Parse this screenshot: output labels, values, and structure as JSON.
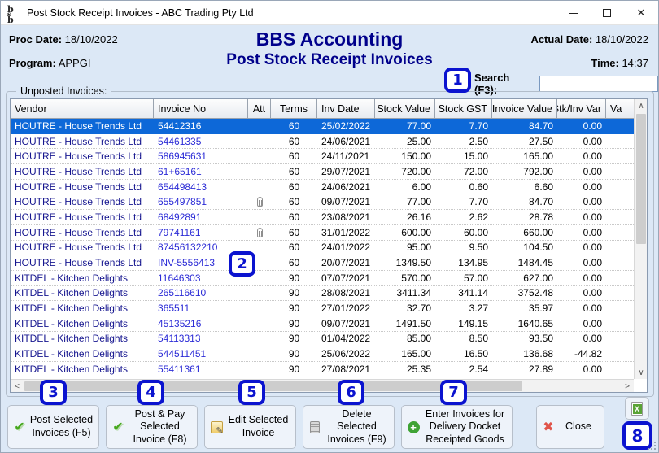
{
  "window": {
    "title": "Post Stock Receipt Invoices - ABC Trading Pty Ltd",
    "app_icon": "bbs-logo"
  },
  "header": {
    "proc_date_label": "Proc Date:",
    "proc_date": "18/10/2022",
    "program_label": "Program:",
    "program": "APPGI",
    "app_title": "BBS Accounting",
    "screen_title": "Post Stock Receipt Invoices",
    "actual_date_label": "Actual Date:",
    "actual_date": "18/10/2022",
    "time_label": "Time:",
    "time": "14:37",
    "search_label": "Search (F3):",
    "search_value": ""
  },
  "table": {
    "group_label": "Unposted Invoices:",
    "columns": [
      "Vendor",
      "Invoice No",
      "Att",
      "Terms",
      "Inv Date",
      "Stock Value",
      "Stock GST",
      "Invoice Value",
      "Stk/Inv Var",
      "Va"
    ],
    "rows": [
      {
        "vendor": "HOUTRE - House Trends Ltd",
        "invoice_no": "54412316",
        "att": false,
        "terms": "60",
        "inv_date": "25/02/2022",
        "stock_value": "77.00",
        "stock_gst": "7.70",
        "invoice_value": "84.70",
        "stk_inv_var": "0.00",
        "selected": true
      },
      {
        "vendor": "HOUTRE - House Trends Ltd",
        "invoice_no": "54461335",
        "att": false,
        "terms": "60",
        "inv_date": "24/06/2021",
        "stock_value": "25.00",
        "stock_gst": "2.50",
        "invoice_value": "27.50",
        "stk_inv_var": "0.00",
        "selected": false
      },
      {
        "vendor": "HOUTRE - House Trends Ltd",
        "invoice_no": "586945631",
        "att": false,
        "terms": "60",
        "inv_date": "24/11/2021",
        "stock_value": "150.00",
        "stock_gst": "15.00",
        "invoice_value": "165.00",
        "stk_inv_var": "0.00",
        "selected": false
      },
      {
        "vendor": "HOUTRE - House Trends Ltd",
        "invoice_no": "61+65161",
        "att": false,
        "terms": "60",
        "inv_date": "29/07/2021",
        "stock_value": "720.00",
        "stock_gst": "72.00",
        "invoice_value": "792.00",
        "stk_inv_var": "0.00",
        "selected": false
      },
      {
        "vendor": "HOUTRE - House Trends Ltd",
        "invoice_no": "654498413",
        "att": false,
        "terms": "60",
        "inv_date": "24/06/2021",
        "stock_value": "6.00",
        "stock_gst": "0.60",
        "invoice_value": "6.60",
        "stk_inv_var": "0.00",
        "selected": false
      },
      {
        "vendor": "HOUTRE - House Trends Ltd",
        "invoice_no": "655497851",
        "att": true,
        "terms": "60",
        "inv_date": "09/07/2021",
        "stock_value": "77.00",
        "stock_gst": "7.70",
        "invoice_value": "84.70",
        "stk_inv_var": "0.00",
        "selected": false
      },
      {
        "vendor": "HOUTRE - House Trends Ltd",
        "invoice_no": "68492891",
        "att": false,
        "terms": "60",
        "inv_date": "23/08/2021",
        "stock_value": "26.16",
        "stock_gst": "2.62",
        "invoice_value": "28.78",
        "stk_inv_var": "0.00",
        "selected": false
      },
      {
        "vendor": "HOUTRE - House Trends Ltd",
        "invoice_no": "79741161",
        "att": true,
        "terms": "60",
        "inv_date": "31/01/2022",
        "stock_value": "600.00",
        "stock_gst": "60.00",
        "invoice_value": "660.00",
        "stk_inv_var": "0.00",
        "selected": false
      },
      {
        "vendor": "HOUTRE - House Trends Ltd",
        "invoice_no": "87456132210",
        "att": false,
        "terms": "60",
        "inv_date": "24/01/2022",
        "stock_value": "95.00",
        "stock_gst": "9.50",
        "invoice_value": "104.50",
        "stk_inv_var": "0.00",
        "selected": false
      },
      {
        "vendor": "HOUTRE - House Trends Ltd",
        "invoice_no": "INV-5556413",
        "att": false,
        "terms": "60",
        "inv_date": "20/07/2021",
        "stock_value": "1349.50",
        "stock_gst": "134.95",
        "invoice_value": "1484.45",
        "stk_inv_var": "0.00",
        "selected": false
      },
      {
        "vendor": "KITDEL - Kitchen Delights",
        "invoice_no": "11646303",
        "att": false,
        "terms": "90",
        "inv_date": "07/07/2021",
        "stock_value": "570.00",
        "stock_gst": "57.00",
        "invoice_value": "627.00",
        "stk_inv_var": "0.00",
        "selected": false
      },
      {
        "vendor": "KITDEL - Kitchen Delights",
        "invoice_no": "265116610",
        "att": false,
        "terms": "90",
        "inv_date": "28/08/2021",
        "stock_value": "3411.34",
        "stock_gst": "341.14",
        "invoice_value": "3752.48",
        "stk_inv_var": "0.00",
        "selected": false
      },
      {
        "vendor": "KITDEL - Kitchen Delights",
        "invoice_no": "365511",
        "att": false,
        "terms": "90",
        "inv_date": "27/01/2022",
        "stock_value": "32.70",
        "stock_gst": "3.27",
        "invoice_value": "35.97",
        "stk_inv_var": "0.00",
        "selected": false
      },
      {
        "vendor": "KITDEL - Kitchen Delights",
        "invoice_no": "45135216",
        "att": false,
        "terms": "90",
        "inv_date": "09/07/2021",
        "stock_value": "1491.50",
        "stock_gst": "149.15",
        "invoice_value": "1640.65",
        "stk_inv_var": "0.00",
        "selected": false
      },
      {
        "vendor": "KITDEL - Kitchen Delights",
        "invoice_no": "54113313",
        "att": false,
        "terms": "90",
        "inv_date": "01/04/2022",
        "stock_value": "85.00",
        "stock_gst": "8.50",
        "invoice_value": "93.50",
        "stk_inv_var": "0.00",
        "selected": false
      },
      {
        "vendor": "KITDEL - Kitchen Delights",
        "invoice_no": "544511451",
        "att": false,
        "terms": "90",
        "inv_date": "25/06/2022",
        "stock_value": "165.00",
        "stock_gst": "16.50",
        "invoice_value": "136.68",
        "stk_inv_var": "-44.82",
        "selected": false
      },
      {
        "vendor": "KITDEL - Kitchen Delights",
        "invoice_no": "55411361",
        "att": false,
        "terms": "90",
        "inv_date": "27/08/2021",
        "stock_value": "25.35",
        "stock_gst": "2.54",
        "invoice_value": "27.89",
        "stk_inv_var": "0.00",
        "selected": false
      }
    ]
  },
  "buttons": [
    {
      "label": "Post Selected Invoices (F5)",
      "icon": "check-icon"
    },
    {
      "label": "Post & Pay Selected Invoice (F8)",
      "icon": "check-icon"
    },
    {
      "label": "Edit Selected Invoice",
      "icon": "edit-note-icon"
    },
    {
      "label": "Delete Selected Invoices (F9)",
      "icon": "shredder-icon"
    },
    {
      "label": "Enter Invoices for Delivery Docket Receipted Goods",
      "icon": "plus-circle-icon"
    },
    {
      "label": "Close",
      "icon": "red-x-icon"
    }
  ],
  "excel_button": {
    "icon": "excel-export-icon"
  },
  "callouts": [
    "1",
    "2",
    "3",
    "4",
    "5",
    "6",
    "7",
    "8"
  ],
  "colors": {
    "window_bg": "#dce8f6",
    "titlebar_bg": "#ffffff",
    "heading_navy": "#00008b",
    "selection_blue": "#0d68d8",
    "vendor_text": "#16168f",
    "invoice_text": "#2b2bd6",
    "callout_blue": "#0b13cf",
    "check_green": "#46a81e",
    "close_red": "#e0544a",
    "excel_green": "#5aa336"
  }
}
